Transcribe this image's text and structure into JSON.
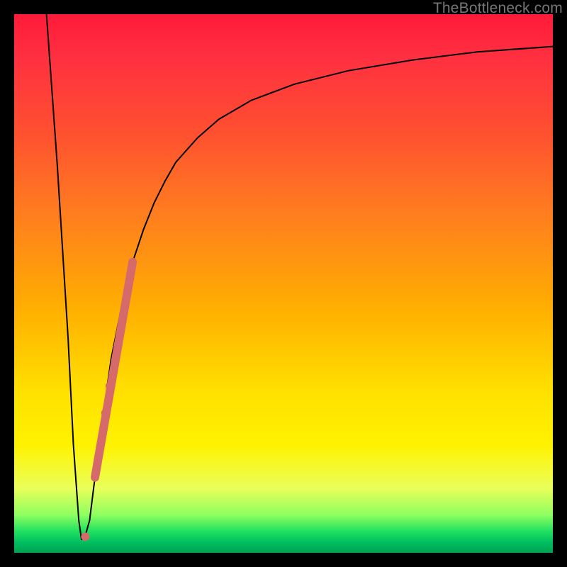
{
  "watermark": "TheBottleneck.com",
  "chart_data": {
    "type": "line",
    "title": "",
    "xlabel": "",
    "ylabel": "",
    "xlim": [
      0,
      100
    ],
    "ylim": [
      0,
      100
    ],
    "grid": false,
    "series": [
      {
        "name": "bottleneck-curve",
        "x": [
          6,
          8,
          10,
          11,
          12,
          12.5,
          13,
          14,
          15,
          16,
          18,
          20,
          22,
          24,
          26,
          28,
          30,
          34,
          38,
          44,
          52,
          62,
          74,
          86,
          100
        ],
        "y": [
          100,
          72,
          40,
          20,
          6,
          2.5,
          2.5,
          6,
          14,
          22,
          36,
          46,
          54,
          60,
          65,
          69,
          72.5,
          77,
          80.5,
          84,
          87,
          89.5,
          91.5,
          93,
          94
        ]
      }
    ],
    "highlight_segment": {
      "start_x": 15,
      "end_x": 22,
      "note": "thick salmon overlay on rising branch"
    },
    "markers": [
      {
        "x": 13.2,
        "y": 3,
        "r": 6
      },
      {
        "x": 16.8,
        "y": 26,
        "r": 5
      },
      {
        "x": 17.6,
        "y": 31,
        "r": 5
      }
    ],
    "colors": {
      "curve": "#000000",
      "accent": "#d66a6a",
      "gradient_top": "#ff1a3a",
      "gradient_bottom": "#00a050"
    }
  }
}
